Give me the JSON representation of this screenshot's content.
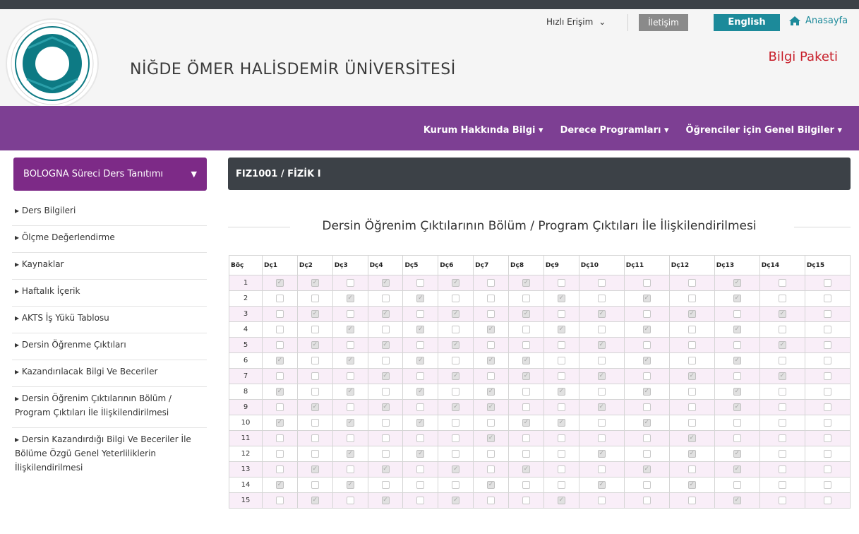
{
  "header": {
    "quick_access": "Hızlı Erişim",
    "contact": "İletişim",
    "english": "English",
    "home": "Anasayfa",
    "university": "NİĞDE ÖMER HALİSDEMİR ÜNİVERSİTESİ",
    "bilgi_paketi": "Bilgi Paketi",
    "logo_year": "1992",
    "logo_text": "NİĞDE ÖMER HALİSDEMİR ÜNİVERSİTESİ"
  },
  "nav": {
    "items": [
      "Kurum Hakkında Bilgi",
      "Derece Programları",
      "Öğrenciler için Genel Bilgiler"
    ]
  },
  "sidebar": {
    "title": "BOLOGNA Süreci Ders Tanıtımı",
    "items": [
      "Ders Bilgileri",
      "Ölçme Değerlendirme",
      "Kaynaklar",
      "Haftalık İçerik",
      "AKTS İş Yükü Tablosu",
      "Dersin Öğrenme Çıktıları",
      "Kazandırılacak Bilgi Ve Beceriler",
      "Dersin Öğrenim Çıktılarının Bölüm / Program Çıktıları İle İlişkilendirilmesi",
      "Dersin Kazandırdığı Bilgi Ve Beceriler İle Bölüme Özgü Genel Yeterliliklerin İlişkilendirilmesi"
    ]
  },
  "course": {
    "code_title": "FIZ1001 / FİZİK I",
    "section_title": "Dersin Öğrenim Çıktılarının Bölüm / Program Çıktıları İle İlişkilendirilmesi"
  },
  "matrix": {
    "row_header": "Böç",
    "columns": [
      "Dç1",
      "Dç2",
      "Dç3",
      "Dç4",
      "Dç5",
      "Dç6",
      "Dç7",
      "Dç8",
      "Dç9",
      "Dç10",
      "Dç11",
      "Dç12",
      "Dç13",
      "Dç14",
      "Dç15"
    ],
    "rows": [
      {
        "label": "1",
        "checks": [
          1,
          1,
          0,
          1,
          0,
          1,
          0,
          1,
          0,
          0,
          0,
          0,
          1,
          0,
          0
        ]
      },
      {
        "label": "2",
        "checks": [
          0,
          0,
          1,
          0,
          1,
          0,
          0,
          0,
          1,
          0,
          1,
          0,
          1,
          0,
          0
        ]
      },
      {
        "label": "3",
        "checks": [
          0,
          1,
          0,
          1,
          0,
          1,
          0,
          1,
          0,
          1,
          0,
          1,
          0,
          1,
          0
        ]
      },
      {
        "label": "4",
        "checks": [
          0,
          0,
          1,
          0,
          1,
          0,
          1,
          0,
          1,
          0,
          1,
          0,
          1,
          0,
          0
        ]
      },
      {
        "label": "5",
        "checks": [
          0,
          1,
          0,
          1,
          0,
          1,
          0,
          0,
          0,
          1,
          0,
          0,
          0,
          1,
          0
        ]
      },
      {
        "label": "6",
        "checks": [
          1,
          0,
          1,
          0,
          1,
          0,
          1,
          1,
          0,
          0,
          1,
          0,
          1,
          0,
          0
        ]
      },
      {
        "label": "7",
        "checks": [
          0,
          0,
          0,
          1,
          0,
          1,
          0,
          1,
          0,
          1,
          0,
          1,
          0,
          1,
          0
        ]
      },
      {
        "label": "8",
        "checks": [
          1,
          0,
          1,
          0,
          1,
          0,
          1,
          0,
          1,
          0,
          1,
          0,
          1,
          0,
          0
        ]
      },
      {
        "label": "9",
        "checks": [
          0,
          1,
          0,
          1,
          0,
          1,
          1,
          0,
          0,
          1,
          0,
          0,
          1,
          0,
          0
        ]
      },
      {
        "label": "10",
        "checks": [
          1,
          0,
          1,
          0,
          1,
          0,
          0,
          1,
          1,
          0,
          1,
          0,
          0,
          0,
          0
        ]
      },
      {
        "label": "11",
        "checks": [
          0,
          0,
          0,
          0,
          0,
          0,
          1,
          0,
          0,
          0,
          0,
          1,
          0,
          0,
          0
        ]
      },
      {
        "label": "12",
        "checks": [
          0,
          0,
          1,
          0,
          1,
          0,
          0,
          0,
          0,
          1,
          0,
          1,
          1,
          0,
          0
        ]
      },
      {
        "label": "13",
        "checks": [
          0,
          1,
          0,
          1,
          0,
          1,
          0,
          1,
          0,
          0,
          1,
          0,
          1,
          0,
          0
        ]
      },
      {
        "label": "14",
        "checks": [
          1,
          0,
          1,
          0,
          0,
          0,
          1,
          0,
          0,
          1,
          0,
          1,
          0,
          0,
          0
        ]
      },
      {
        "label": "15",
        "checks": [
          0,
          1,
          0,
          1,
          0,
          1,
          0,
          0,
          1,
          0,
          0,
          0,
          1,
          0,
          0
        ]
      }
    ]
  }
}
